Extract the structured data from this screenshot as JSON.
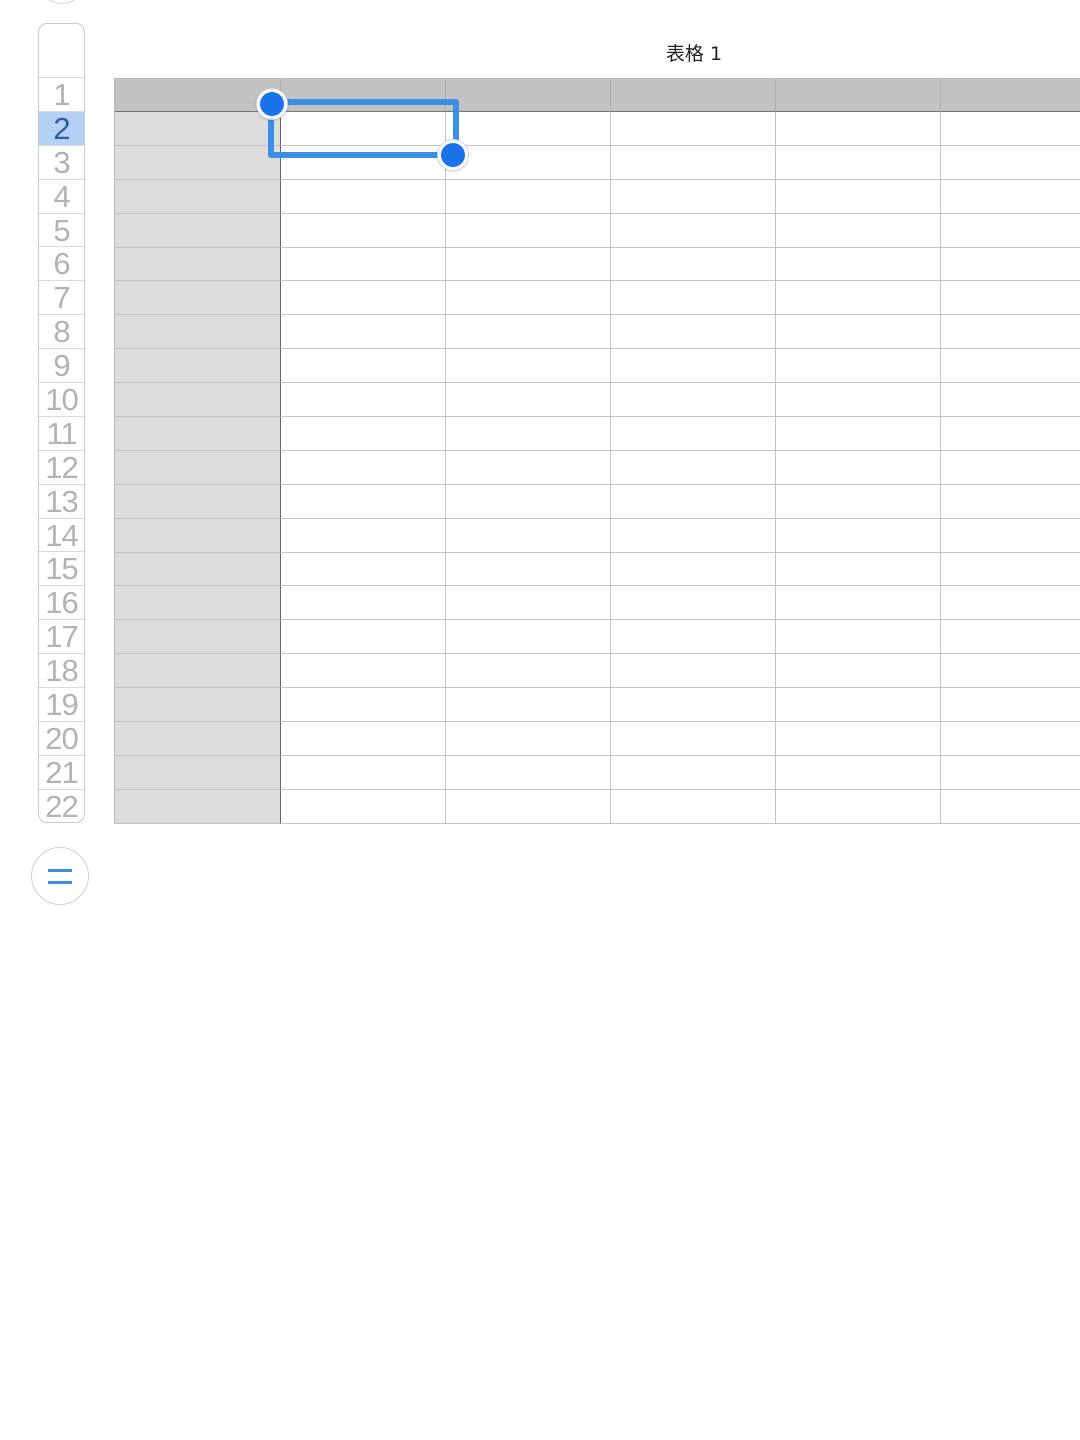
{
  "table": {
    "title": "表格 1",
    "columns": 6,
    "rows": 22,
    "selected_row": "2",
    "row_numbers": [
      "1",
      "2",
      "3",
      "4",
      "5",
      "6",
      "7",
      "8",
      "9",
      "10",
      "11",
      "12",
      "13",
      "14",
      "15",
      "16",
      "17",
      "18",
      "19",
      "20",
      "21",
      "22"
    ]
  },
  "icons": {
    "menu": "equal-menu-icon",
    "top_handle": "table-move-handle-icon"
  },
  "colors": {
    "accent": "#3a8ee6",
    "selection_handle": "#1a73e8",
    "header_fill": "#c2c2c2",
    "row_header_fill": "#dcdcdc",
    "selected_row_index_fill": "#b3d0f5"
  }
}
